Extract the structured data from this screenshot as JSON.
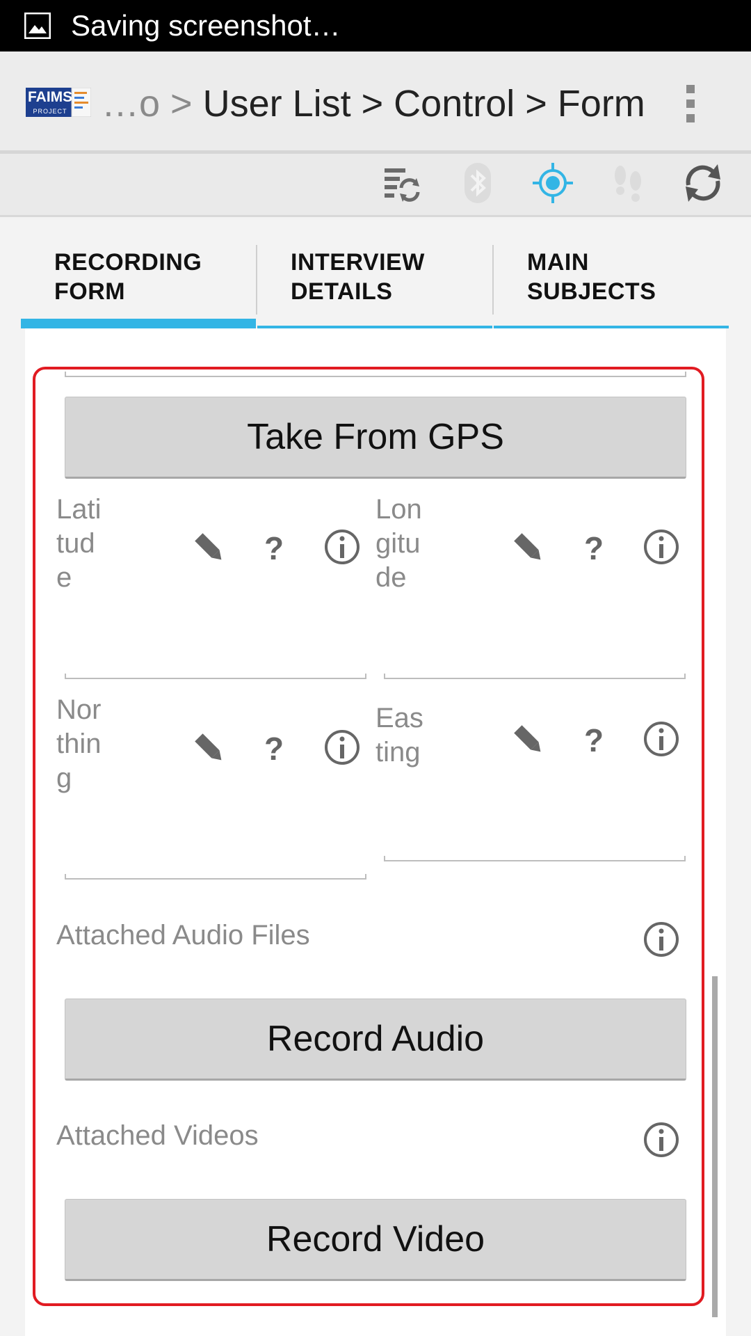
{
  "status_bar": {
    "text": "Saving screenshot…",
    "icon": "image-icon"
  },
  "action_bar": {
    "logo_text": "FAIMS",
    "logo_sub": "PROJECT",
    "breadcrumb_prefix": "…o >",
    "breadcrumb": "User List > Control > Form",
    "overflow_icon": "overflow-menu-icon"
  },
  "toolbar": {
    "icons": [
      "sync-settings-icon",
      "bluetooth-icon",
      "gps-icon",
      "footsteps-icon",
      "refresh-icon"
    ],
    "active_color": "#33b5e5"
  },
  "tabs": [
    {
      "line1": "RECORDING",
      "line2": "FORM"
    },
    {
      "line1": "INTERVIEW",
      "line2": "DETAILS"
    },
    {
      "line1": "MAIN",
      "line2": "SUBJECTS"
    }
  ],
  "form": {
    "take_gps_label": "Take From GPS",
    "latitude": [
      "Lati",
      "tud",
      "e"
    ],
    "longitude": [
      "Lon",
      "gitu",
      "de"
    ],
    "northing": [
      "Nor",
      "thin",
      "g"
    ],
    "easting": [
      "Eas",
      "ting"
    ],
    "audio_label": "Attached Audio Files",
    "record_audio_label": "Record Audio",
    "video_label": "Attached Videos",
    "record_video_label": "Record Video"
  }
}
